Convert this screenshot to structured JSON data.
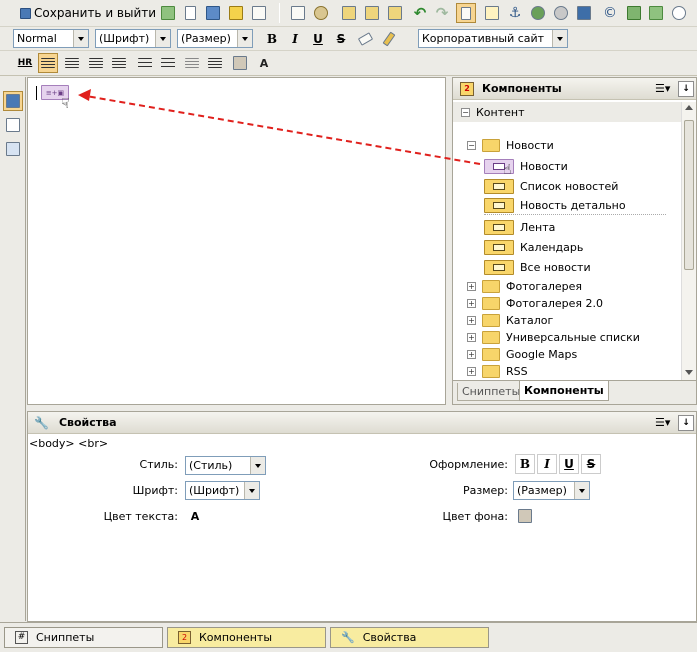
{
  "toolbar1": {
    "save_exit_label": "Сохранить и выйти"
  },
  "toolbar2": {
    "style_select": "Normal",
    "font_select": "(Шрифт)",
    "size_select": "(Размер)",
    "bold": "B",
    "italic": "I",
    "underline": "U",
    "strike": "S",
    "template_select": "Корпоративный сайт"
  },
  "toolbar3": {
    "hr": "HR"
  },
  "components_panel": {
    "title": "Компоненты",
    "root": "Контент",
    "folder_news": "Новости",
    "news_items": [
      "Новости",
      "Список новостей",
      "Новость детально",
      "Лента",
      "Календарь",
      "Все новости"
    ],
    "folders": [
      "Фотогалерея",
      "Фотогалерея 2.0",
      "Каталог",
      "Универсальные списки",
      "Google Maps",
      "RSS"
    ],
    "tab_snippets": "Сниппеты",
    "tab_components": "Компоненты"
  },
  "properties_panel": {
    "title": "Свойства",
    "path": "<body> <br>",
    "style_label": "Стиль:",
    "style_value": "(Стиль)",
    "font_label": "Шрифт:",
    "font_value": "(Шрифт)",
    "text_color_label": "Цвет текста:",
    "decoration_label": "Оформление:",
    "size_label": "Размер:",
    "size_value": "(Размер)",
    "bg_color_label": "Цвет фона:"
  },
  "bottom_tabs": [
    "Сниппеты",
    "Компоненты",
    "Свойства"
  ],
  "colors": {
    "drag_arrow": "#e0201c",
    "active_tab": "#f8eca0",
    "accent_blue": "#3c6fb0"
  }
}
